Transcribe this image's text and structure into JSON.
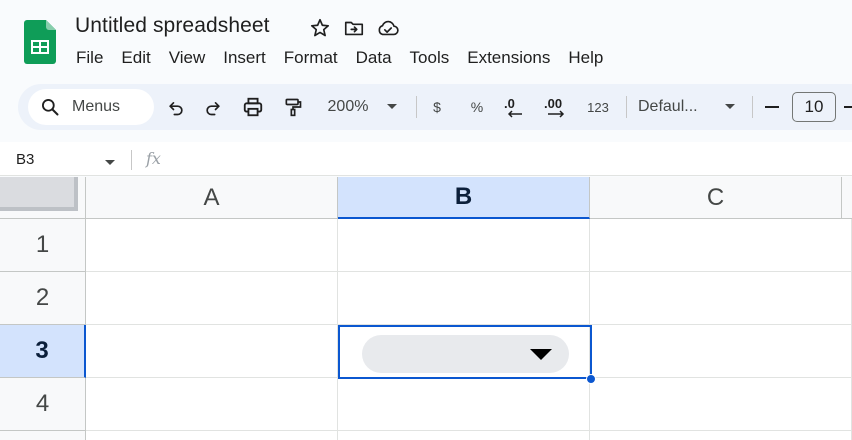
{
  "app": {
    "title": "Untitled spreadsheet",
    "icons": [
      "sheets-logo-icon",
      "star-icon",
      "move-to-folder-icon",
      "cloud-saved-icon"
    ]
  },
  "menubar": {
    "items": [
      "File",
      "Edit",
      "View",
      "Insert",
      "Format",
      "Data",
      "Tools",
      "Extensions",
      "Help"
    ]
  },
  "toolbar": {
    "search_label": "Menus",
    "zoom": "200%",
    "currency_label": "$",
    "percent_label": "%",
    "decrease_decimal_label": ".0",
    "increase_decimal_label": ".00",
    "more_formats_label": "123",
    "font_label": "Defaul...",
    "font_size": "10",
    "icons": [
      "search-icon",
      "undo-icon",
      "redo-icon",
      "print-icon",
      "paint-format-icon",
      "chevron-down-icon",
      "minus-icon"
    ]
  },
  "formula_bar": {
    "cell_ref": "B3",
    "fx_label": "fx",
    "value": ""
  },
  "grid": {
    "columns": [
      "A",
      "B",
      "C"
    ],
    "rows": [
      "1",
      "2",
      "3",
      "4"
    ],
    "selected_column": "B",
    "selected_row": "3",
    "active_cell": "B3"
  },
  "colors": {
    "accent": "#0b57d0",
    "selected_header": "#d3e3fd",
    "toolbar_bg": "#edf2fa",
    "logo_green": "#0f9d58",
    "chip_bg": "#e8eaed"
  }
}
